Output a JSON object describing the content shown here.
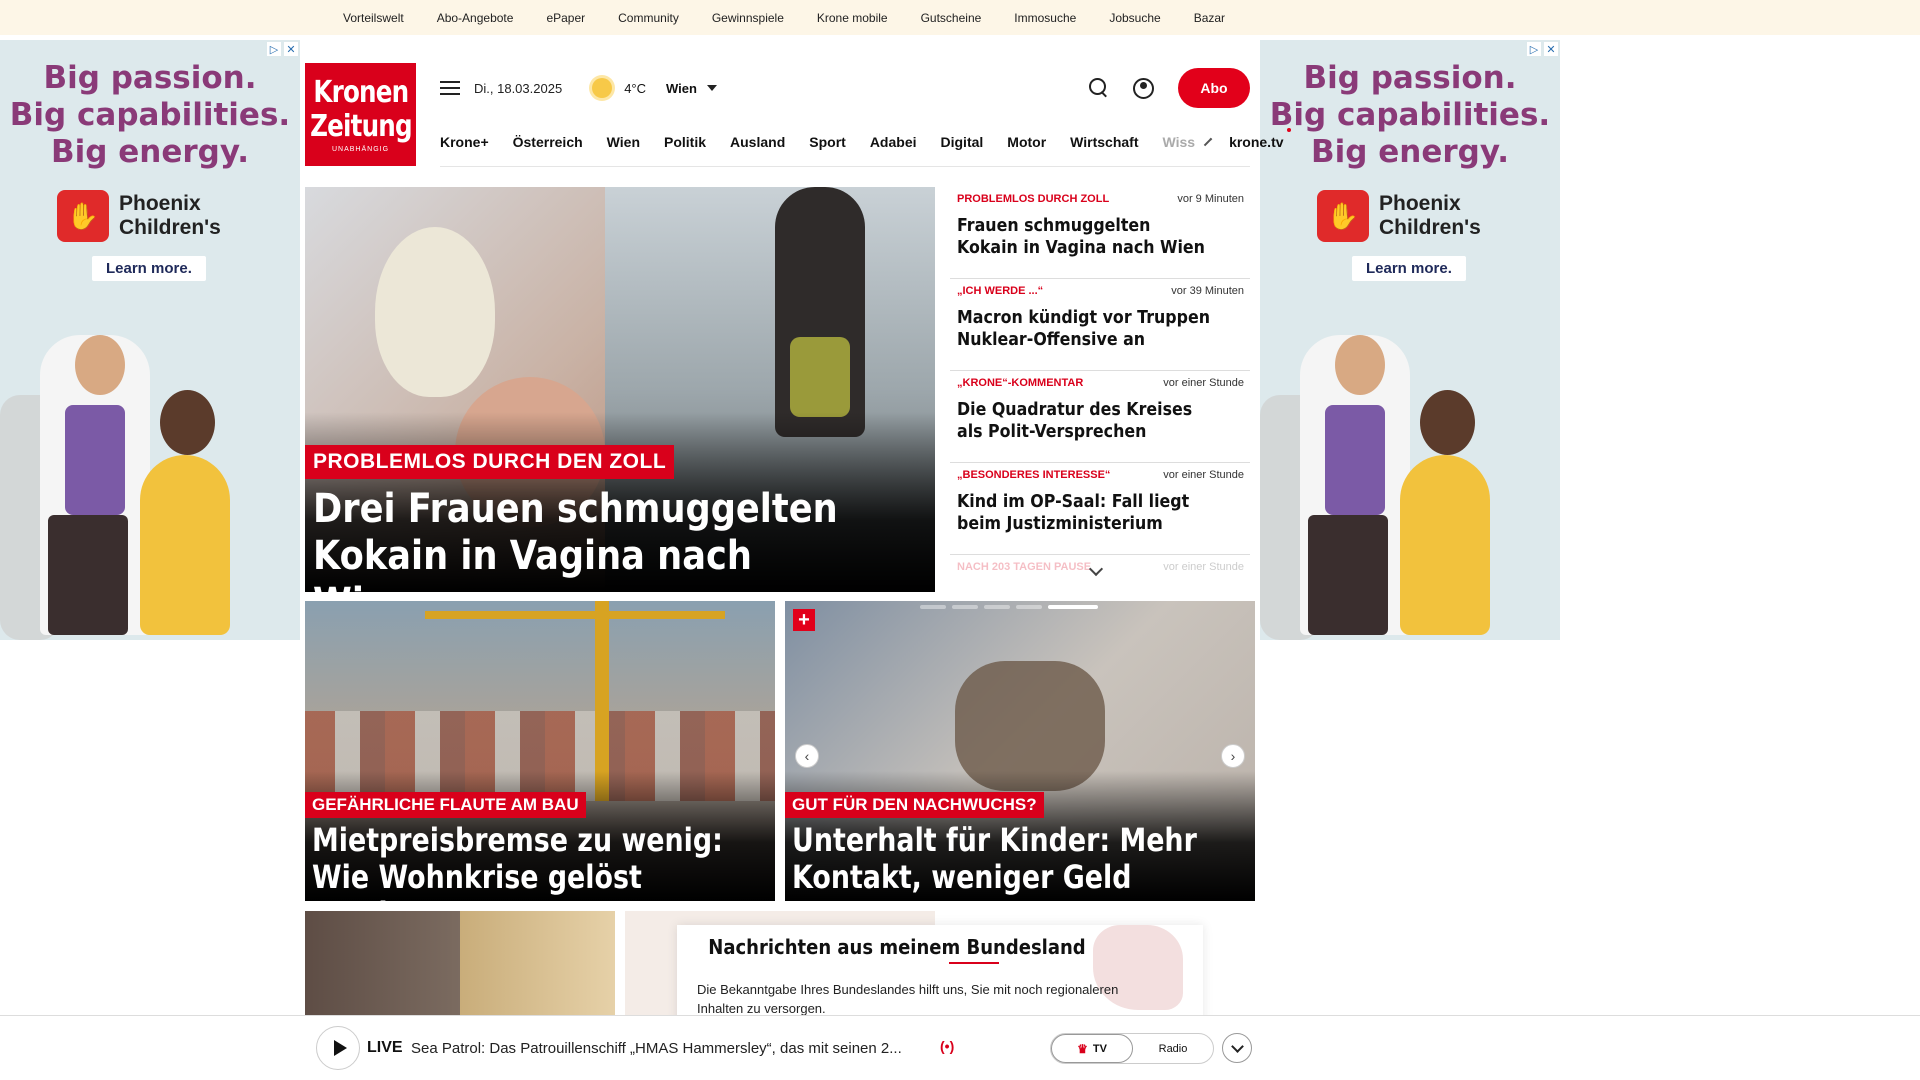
{
  "topbar": {
    "links": [
      "Vorteilswelt",
      "Abo-Angebote",
      "ePaper",
      "Community",
      "Gewinnspiele",
      "Krone mobile",
      "Gutscheine",
      "Immosuche",
      "Jobsuche",
      "Bazar"
    ]
  },
  "ad": {
    "headline": [
      "Big passion.",
      "Big capabilities.",
      "Big energy."
    ],
    "brand_line1": "Phoenix",
    "brand_line2": "Children's",
    "cta": "Learn more.",
    "adchoices_icon": "adchoices-icon",
    "close_icon": "close-icon"
  },
  "logo": {
    "line1": "Kronen",
    "line2": "Zeitung",
    "tagline": "UNABHÄNGIG"
  },
  "header": {
    "date": "Di., 18.03.2025",
    "temperature": "4°C",
    "city": "Wien",
    "abo_label": "Abo"
  },
  "nav": {
    "items": [
      "Krone+",
      "Österreich",
      "Wien",
      "Politik",
      "Ausland",
      "Sport",
      "Adabei",
      "Digital",
      "Motor",
      "Wirtschaft"
    ],
    "faded": "Wiss",
    "tv": "krone.tv"
  },
  "hero": {
    "kicker": "PROBLEMLOS DURCH DEN ZOLL",
    "title": "Drei Frauen schmuggelten Kokain in Vagina nach Wien"
  },
  "list": [
    {
      "kicker": "PROBLEMLOS DURCH ZOLL",
      "time": "vor 9 Minuten",
      "title": "Frauen schmuggelten Kokain in Vagina nach Wien"
    },
    {
      "kicker": "„ICH WERDE ...“",
      "time": "vor 39 Minuten",
      "title": "Macron kündigt vor Truppen Nuklear-Offensive an"
    },
    {
      "kicker": "„KRONE“-KOMMENTAR",
      "time": "vor einer Stunde",
      "title": "Die Quadratur des Kreises als Polit-Versprechen"
    },
    {
      "kicker": "„BESONDERES INTERESSE“",
      "time": "vor einer Stunde",
      "title": "Kind im OP-Saal: Fall liegt beim Justizministerium"
    },
    {
      "kicker": "NACH 203 TAGEN PAUSE",
      "time": "vor einer Stunde",
      "title": ""
    }
  ],
  "tiles": [
    {
      "kicker": "GEFÄHRLICHE FLAUTE AM BAU",
      "title": "Mietpreisbremse zu wenig: Wie Wohnkrise gelöst werden muss"
    },
    {
      "kicker": "GUT FÜR DEN NACHWUCHS?",
      "title": "Unterhalt für Kinder: Mehr Kontakt, weniger Geld"
    }
  ],
  "regional": {
    "title": "Nachrichten aus meinem Bundesland",
    "text": "Die Bekanntgabe Ihres Bundeslandes hilft uns, Sie mit noch regionaleren Inhalten zu versorgen."
  },
  "player": {
    "live": "LIVE",
    "title": "Sea Patrol: Das Patrouillenschiff „HMAS Hammersley“, das mit seinen 2...",
    "broadcast_icon": "(•)",
    "tv": "TV",
    "radio": "Radio"
  },
  "colors": {
    "brand_red": "#d9001b",
    "topbar_bg": "#fdf6e7",
    "ad_bg": "#dde9ec",
    "ad_text": "#8a3a78"
  }
}
